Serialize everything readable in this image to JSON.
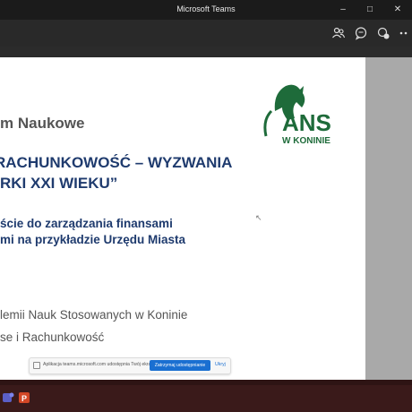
{
  "window": {
    "title": "Microsoft Teams"
  },
  "toolbar": {
    "icons": [
      "people-icon",
      "chat-icon",
      "reactions-icon",
      "more-icon"
    ]
  },
  "slide": {
    "heading_partial": "m Naukowe",
    "main_title_line1": "RACHUNKOWOŚĆ – WYZWANIA",
    "main_title_line2": "RKI XXI WIEKU”",
    "subtitle_line1": "ście do zarządzania finansami",
    "subtitle_line2": "mi na przykładzie Urzędu Miasta",
    "institution_line1": "lemii Nauk Stosowanych w Koninie",
    "institution_line2": "se i Rachunkowość",
    "logo": {
      "name": "ANS",
      "sub": "W KONINIE",
      "color": "#1e6b3a"
    }
  },
  "share_bar": {
    "message": "Aplikacja teams.microsoft.com udostępnia Twój ekran.",
    "stop_label": "Zatrzymaj udostępnianie",
    "hide_label": "Ukryj"
  },
  "taskbar": {
    "apps": [
      "teams-taskbar-icon",
      "powerpoint-taskbar-icon"
    ]
  }
}
